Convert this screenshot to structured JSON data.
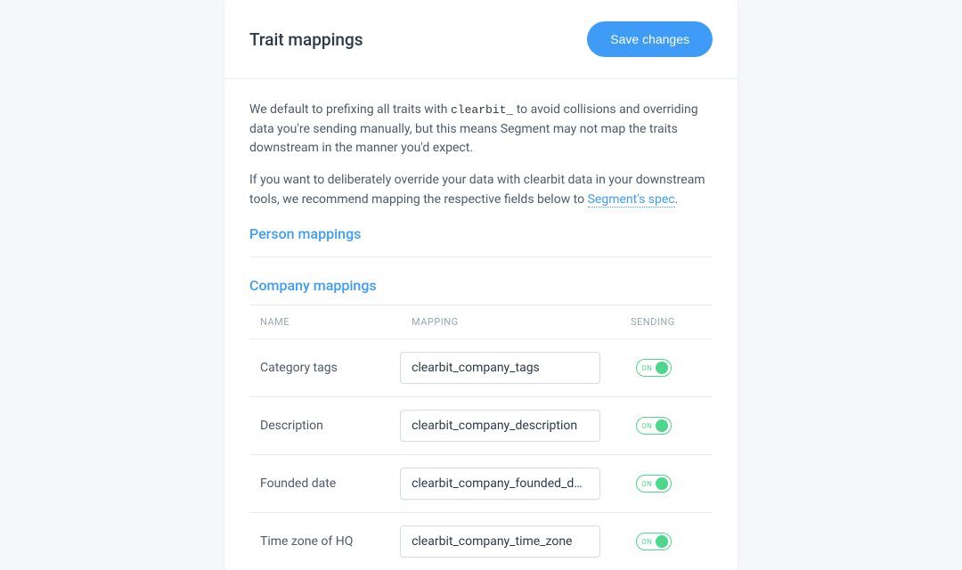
{
  "header": {
    "title": "Trait mappings",
    "save_label": "Save changes"
  },
  "description": {
    "para1_pre": "We default to prefixing all traits with ",
    "para1_code": "clearbit_",
    "para1_post": " to avoid collisions and overriding data you're sending manually, but this means Segment may not map the traits downstream in the manner you'd expect.",
    "para2_pre": "If you want to deliberately override your data with clearbit data in your downstream tools, we recommend mapping the respective fields below to ",
    "para2_link": "Segment's spec",
    "para2_post": "."
  },
  "sections": {
    "person_title": "Person mappings",
    "company_title": "Company mappings"
  },
  "table": {
    "col_name": "NAME",
    "col_mapping": "MAPPING",
    "col_sending": "SENDING"
  },
  "company_rows": [
    {
      "name": "Category tags",
      "mapping": "clearbit_company_tags",
      "sending": true,
      "toggle_label": "ON"
    },
    {
      "name": "Description",
      "mapping": "clearbit_company_description",
      "sending": true,
      "toggle_label": "ON"
    },
    {
      "name": "Founded date",
      "mapping": "clearbit_company_founded_date",
      "sending": true,
      "toggle_label": "ON"
    },
    {
      "name": "Time zone of HQ",
      "mapping": "clearbit_company_time_zone",
      "sending": true,
      "toggle_label": "ON"
    }
  ]
}
